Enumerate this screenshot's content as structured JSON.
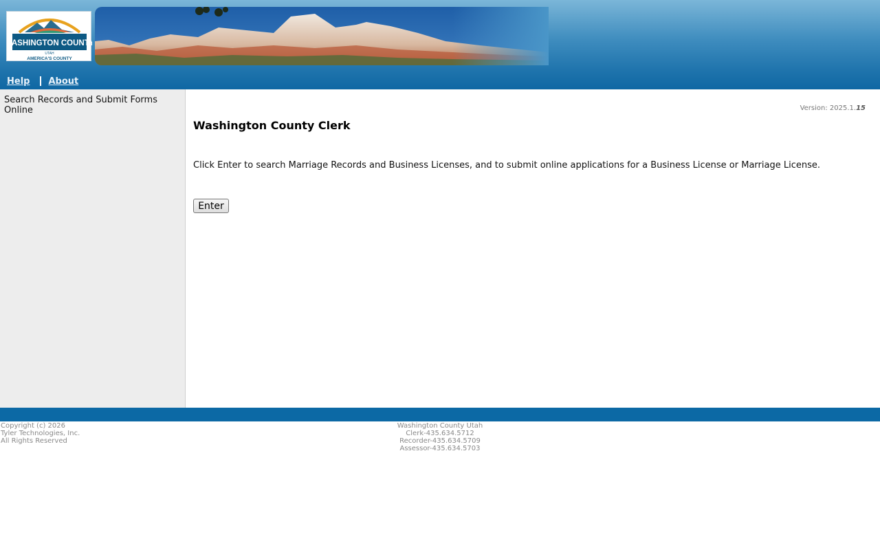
{
  "header": {
    "logo": {
      "name": "WASHINGTON COUNTY",
      "state": "UTAH",
      "tagline": "AMERICA'S COUNTY"
    },
    "nav": [
      {
        "label": "Help"
      },
      {
        "label": "About"
      }
    ]
  },
  "sidebar": {
    "text": "Search Records and Submit Forms Online"
  },
  "main": {
    "version_prefix": "Version: 2025.1.",
    "version_build": "15",
    "title": "Washington County Clerk",
    "intro": "Click Enter to search Marriage Records and Business Licenses, and to submit online applications for a Business License or Marriage License.",
    "enter_label": "Enter"
  },
  "footer": {
    "left": [
      "Copyright (c) 2026",
      "Tyler Technologies, Inc.",
      "All Rights Reserved"
    ],
    "center": [
      "Washington County Utah",
      "Clerk-435.634.5712",
      "Recorder-435.634.5709",
      "Assessor-435.634.5703"
    ]
  },
  "colors": {
    "header_blue": "#0f67a3",
    "footer_bar": "#0c69a5",
    "sidebar_bg": "#ededed"
  }
}
